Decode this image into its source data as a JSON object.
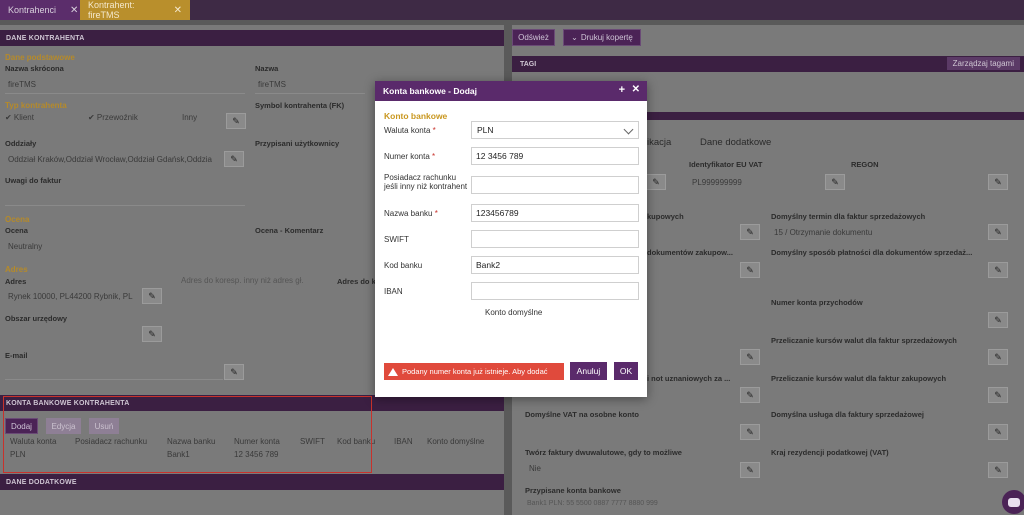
{
  "tabs": [
    {
      "label": "Kontrahenci"
    },
    {
      "label": "Kontrahent: fireTMS"
    }
  ],
  "close_glyph": "✕",
  "left": {
    "section_dane": "DANE KONTRAHENTA",
    "group_podstawowe": "Dane podstawowe",
    "nazwa_skrocona_label": "Nazwa skrócona",
    "nazwa_skrocona_value": "fireTMS",
    "nazwa_label": "Nazwa",
    "nazwa_value": "fireTMS",
    "group_typ": "Typ kontrahenta",
    "typ_klient": "✔ Klient",
    "typ_przewoznik": "✔ Przewoźnik",
    "typ_inny": "Inny",
    "symbol_label": "Symbol kontrahenta (FK)",
    "oddzialy_label": "Oddziały",
    "oddzialy_value": "Oddział Kraków,Oddział Wrocław,Oddział Gdańsk,Oddzia",
    "przypisani_label": "Przypisani użytkownicy",
    "uwagi_label": "Uwagi do faktur",
    "group_ocena": "Ocena",
    "ocena_label": "Ocena",
    "ocena_value": "Neutralny",
    "ocena_komentarz_label": "Ocena - Komentarz",
    "group_adres": "Adres",
    "adres_label": "Adres",
    "adres_value": "Rynek 10000, PL44200 Rybnik, PL",
    "adres_koresp_placeholder": "Adres do koresp. inny niż adres gł.",
    "adres_do_label": "Adres do k",
    "obszar_label": "Obszar urzędowy",
    "email_label": "E-mail",
    "section_konta": "KONTA BANKOWE KONTRAHENTA",
    "btn_dodaj": "Dodaj",
    "btn_edycja": "Edycja",
    "btn_usun": "Usuń",
    "table_headers": [
      "Waluta konta",
      "Posiadacz rachunku",
      "Nazwa banku",
      "Numer konta",
      "SWIFT",
      "Kod banku",
      "IBAN",
      "Konto domyślne"
    ],
    "table_row": [
      "PLN",
      "",
      "Bank1",
      "12 3456 789",
      "",
      "",
      "",
      ""
    ],
    "section_dodatkowe": "DANE DODATKOWE"
  },
  "right": {
    "btn_odswiez": "Odśwież",
    "btn_drukuj": "Drukuj kopertę",
    "tags_label": "TAGI",
    "tags_button": "Zarządzaj tagami",
    "tab_ikacja": "ikacja",
    "tab_dodatkowe": "Dane dodatkowe",
    "eu_vat_label": "Identyfikator EU VAT",
    "eu_vat_value": "PL999999999",
    "regon_label": "REGON",
    "kupowych_label": "kupowych",
    "termin_label": "Domyślny termin dla faktur sprzedażowych",
    "termin_value": "15 / Otrzymanie dokumentu",
    "dok_zakupowych_label": "dokumentów zakupow...",
    "sposob_label": "Domyślny sposób płatności dla dokumentów sprzedaż...",
    "numer_przychodow_label": "Numer konta przychodów",
    "przeliczanie_sprz_label": "Przeliczanie kursów walut dla faktur sprzedażowych",
    "nieuznaniowych_label": "i not uznaniowych za ...",
    "przeliczanie_zak_label": "Przeliczanie kursów walut dla faktur zakupowych",
    "vat_osobne_label": "Domyślne VAT na osobne konto",
    "usluga_label": "Domyślna usługa dla faktury sprzedażowej",
    "dwuwalutowe_label": "Twórz faktury dwuwalutowe, gdy to możliwe",
    "dwuwalutowe_value": "Nie",
    "kraj_label": "Kraj rezydencji podatkowej (VAT)",
    "przypisane_label": "Przypisane konta bankowe",
    "przypisane_value": "Bank1 PLN: 55 5500 0887 7777 8880 999"
  },
  "modal": {
    "title": "Konta bankowe - Dodaj",
    "plus": "+",
    "close": "✕",
    "group": "Konto bankowe",
    "waluta_label": "Waluta konta",
    "waluta_value": "PLN",
    "numer_label": "Numer konta",
    "numer_value": "12 3456 789",
    "posiadacz_label_1": "Posiadacz rachunku",
    "posiadacz_label_2": "jeśli inny niż kontrahent",
    "posiadacz_value": "",
    "nazwa_banku_label": "Nazwa banku",
    "nazwa_banku_value": "123456789",
    "swift_label": "SWIFT",
    "swift_value": "",
    "kod_label": "Kod banku",
    "kod_value": "Bank2",
    "iban_label": "IBAN",
    "iban_value": "",
    "domyslne_label": "Konto domyślne",
    "error": "Podany numer konta już istnieje. Aby dodać",
    "btn_anuluj": "Anuluj",
    "btn_ok": "OK",
    "req_mark": "*"
  },
  "colors": {
    "header_purple": "#5a2a6b",
    "accent_gold": "#c9971f",
    "error_red": "#e04a3c"
  }
}
